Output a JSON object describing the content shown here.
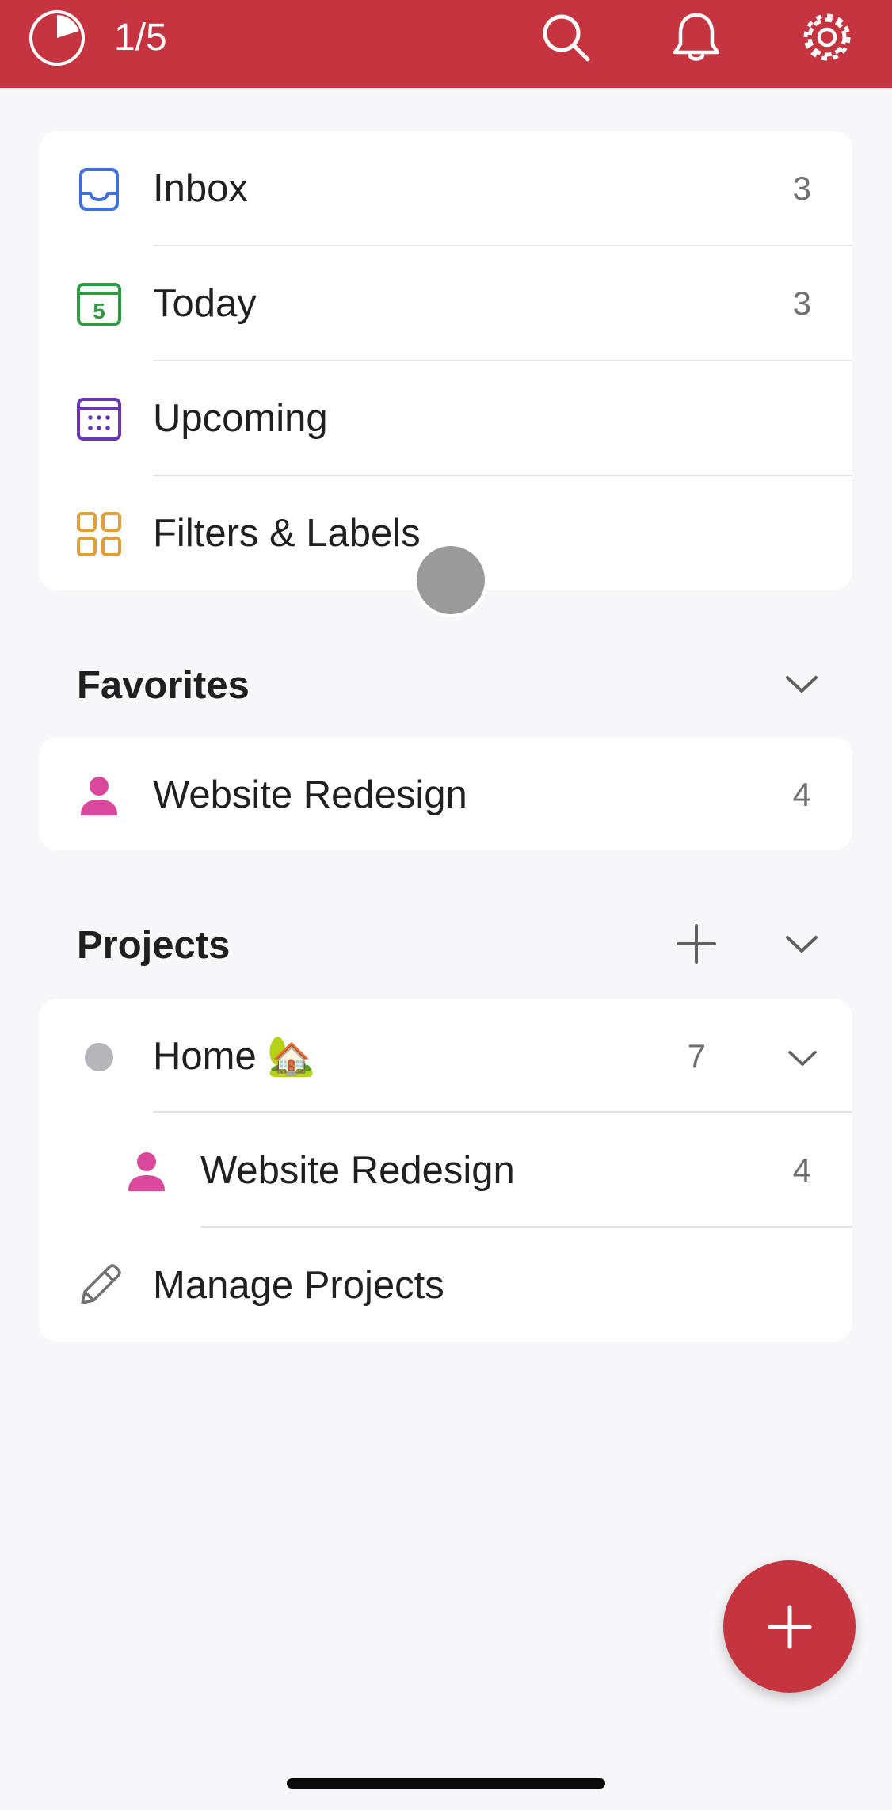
{
  "header": {
    "progress_text": "1/5",
    "progress_fraction": 0.2,
    "background_color": "#c63440",
    "icons": [
      "progress-icon",
      "search-icon",
      "bell-icon",
      "gear-icon"
    ]
  },
  "nav": {
    "inbox": {
      "label": "Inbox",
      "count": "3",
      "icon": "inbox-icon",
      "color": "#3f6fd8"
    },
    "today": {
      "label": "Today",
      "count": "3",
      "day": "5",
      "icon": "calendar-today-icon",
      "color": "#2f9a3f"
    },
    "upcoming": {
      "label": "Upcoming",
      "icon": "calendar-upcoming-icon",
      "color": "#6a35b8"
    },
    "filters": {
      "label": "Filters & Labels",
      "icon": "grid-icon",
      "color": "#e0a038"
    }
  },
  "favorites": {
    "title": "Favorites",
    "items": [
      {
        "label": "Website Redesign",
        "count": "4",
        "icon": "person-icon",
        "color": "#d9489a"
      }
    ]
  },
  "projects": {
    "title": "Projects",
    "items": [
      {
        "label": "Home 🏡",
        "count": "7",
        "icon": "dot-icon",
        "color": "#b5b5ba"
      },
      {
        "label": "Website Redesign",
        "count": "4",
        "icon": "person-icon",
        "color": "#d9489a"
      }
    ],
    "manage_label": "Manage Projects"
  },
  "fab": {
    "icon": "plus-icon",
    "color": "#c63440"
  }
}
